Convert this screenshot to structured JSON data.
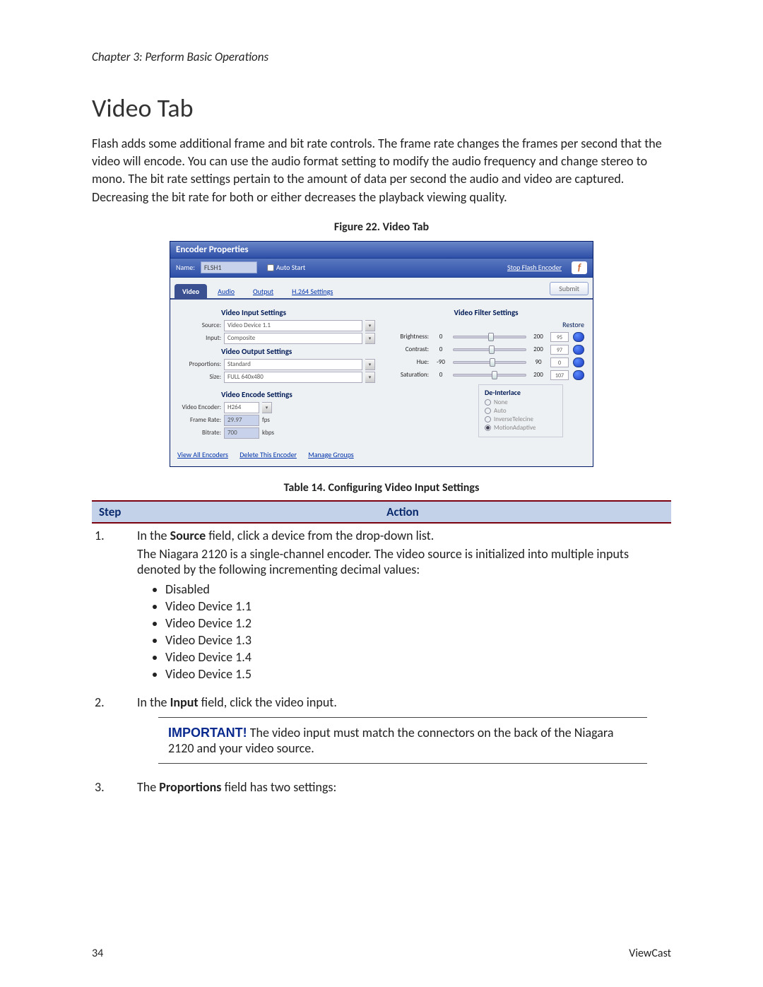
{
  "chapter_header": "Chapter 3: Perform Basic Operations",
  "section_title": "Video Tab",
  "body_paragraph": "Flash adds some additional frame and bit rate controls. The frame rate changes the frames per second that the video will encode. You can use the audio format setting to modify the audio frequency and change stereo to mono. The bit rate settings pertain to the amount of data per second the audio and video are captured. Decreasing the bit rate for both or either decreases the playback viewing quality.",
  "figure_caption": "Figure 22. Video Tab",
  "table_caption": "Table 14. Configuring Video Input Settings",
  "app": {
    "title": "Encoder Properties",
    "name_label": "Name:",
    "name_value": "FLSH1",
    "auto_start_label": "Auto Start",
    "stop_link": "Stop Flash Encoder",
    "tabs": [
      "Video",
      "Audio",
      "Output",
      "H.264 Settings"
    ],
    "submit_label": "Submit",
    "left": {
      "input_title": "Video Input Settings",
      "output_title": "Video Output Settings",
      "encode_title": "Video Encode Settings",
      "source_label": "Source:",
      "source_value": "Video Device 1.1",
      "input_label": "Input:",
      "input_value": "Composite",
      "proportions_label": "Proportions:",
      "proportions_value": "Standard",
      "size_label": "Size:",
      "size_value": "FULL 640x480",
      "encoder_label": "Video Encoder:",
      "encoder_value": "H264",
      "framerate_label": "Frame Rate:",
      "framerate_value": "29.97",
      "framerate_unit": "fps",
      "bitrate_label": "Bitrate:",
      "bitrate_value": "700",
      "bitrate_unit": "kbps"
    },
    "right": {
      "filter_title": "Video Filter Settings",
      "restore_label": "Restore",
      "sliders": [
        {
          "label": "Brightness:",
          "min": "0",
          "max": "200",
          "val": "95",
          "pos": 48
        },
        {
          "label": "Contrast:",
          "min": "0",
          "max": "200",
          "val": "97",
          "pos": 49
        },
        {
          "label": "Hue:",
          "min": "-90",
          "max": "90",
          "val": "0",
          "pos": 50
        },
        {
          "label": "Saturation:",
          "min": "0",
          "max": "200",
          "val": "107",
          "pos": 53
        }
      ],
      "di_title": "De-Interlace",
      "di_options": [
        "None",
        "Auto",
        "InverseTelecine",
        "MotionAdaptive"
      ],
      "di_selected": 3
    },
    "footer_links": [
      "View All Encoders",
      "Delete This Encoder",
      "Manage Groups"
    ]
  },
  "table": {
    "head_step": "Step",
    "head_action": "Action",
    "rows": [
      {
        "num": "1.",
        "line1_pre": "In the ",
        "line1_bold": "Source",
        "line1_post": " field, click a device from the drop-down list.",
        "para": "The Niagara 2120 is a single-channel encoder. The video source is initialized into multiple inputs denoted by the following incrementing decimal values:",
        "bullets": [
          "Disabled",
          "Video Device 1.1",
          "Video Device 1.2",
          "Video Device 1.3",
          "Video Device 1.4",
          "Video Device 1.5"
        ]
      },
      {
        "num": "2.",
        "line1_pre": "In the ",
        "line1_bold": "Input",
        "line1_post": " field, click the video input.",
        "important_label": "IMPORTANT!",
        "important_text": " The video input must match the connectors on the back of the Niagara 2120 and your video source."
      },
      {
        "num": "3.",
        "line1_pre": "The ",
        "line1_bold": "Proportions",
        "line1_post": " field has two settings:"
      }
    ]
  },
  "page_num": "34",
  "brand": "ViewCast"
}
